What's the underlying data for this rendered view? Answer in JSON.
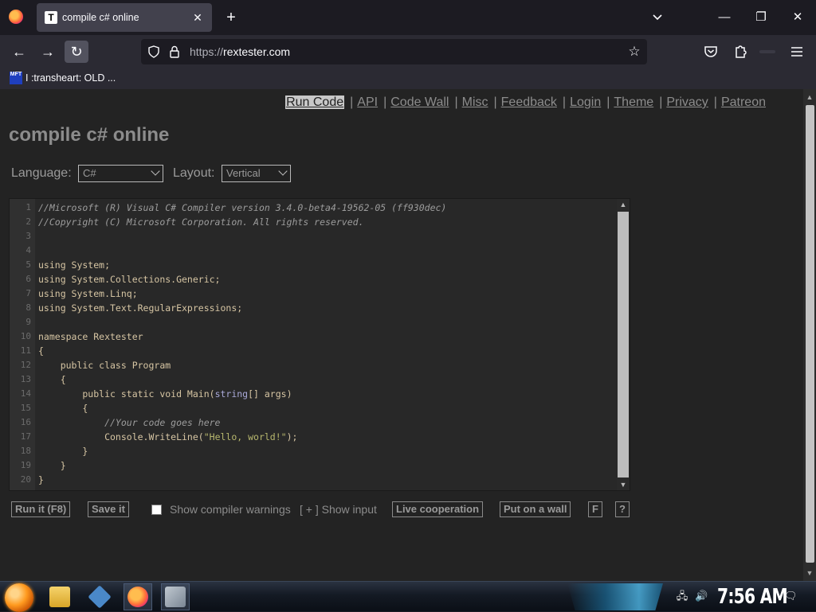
{
  "browser": {
    "tab": {
      "favicon_letter": "T",
      "title": "compile c# online"
    },
    "url_scheme": "https://",
    "url_host": "rextester.com",
    "bookmark": {
      "favicon_text": "MFT",
      "label": "I :transheart: OLD ..."
    }
  },
  "page": {
    "nav": [
      "Run Code",
      "API",
      "Code Wall",
      "Misc",
      "Feedback",
      "Login",
      "Theme",
      "Privacy",
      "Patreon"
    ],
    "title": "compile c# online",
    "language_label": "Language:",
    "language_value": "C#",
    "layout_label": "Layout:",
    "layout_value": "Vertical",
    "line_numbers": [
      "1",
      "2",
      "3",
      "4",
      "5",
      "6",
      "7",
      "8",
      "9",
      "10",
      "11",
      "12",
      "13",
      "14",
      "15",
      "16",
      "17",
      "18",
      "19",
      "20"
    ],
    "code": {
      "l1": "//Microsoft (R) Visual C# Compiler version 3.4.0-beta4-19562-05 (ff930dec)",
      "l2": "//Copyright (C) Microsoft Corporation. All rights reserved.",
      "l5": "using System;",
      "l6": "using System.Collections.Generic;",
      "l7": "using System.Linq;",
      "l8": "using System.Text.RegularExpressions;",
      "l10": "namespace Rextester",
      "l11": "{",
      "l12": "    public class Program",
      "l13": "    {",
      "l14_a": "        public static void Main(",
      "l14_b": "string",
      "l14_c": "[] args)",
      "l15": "        {",
      "l16": "            //Your code goes here",
      "l17_a": "            Console.WriteLine(",
      "l17_b": "\"Hello, world!\"",
      "l17_c": ");",
      "l18": "        }",
      "l19": "    }",
      "l20": "}"
    },
    "actions": {
      "run": "Run it (F8)",
      "save": "Save it",
      "warnings_label": "Show compiler warnings",
      "show_input": "[ + ] Show input",
      "live": "Live cooperation",
      "wall": "Put on a wall",
      "f": "F",
      "help": "?"
    }
  },
  "taskbar": {
    "clock": "7:56 AM"
  }
}
